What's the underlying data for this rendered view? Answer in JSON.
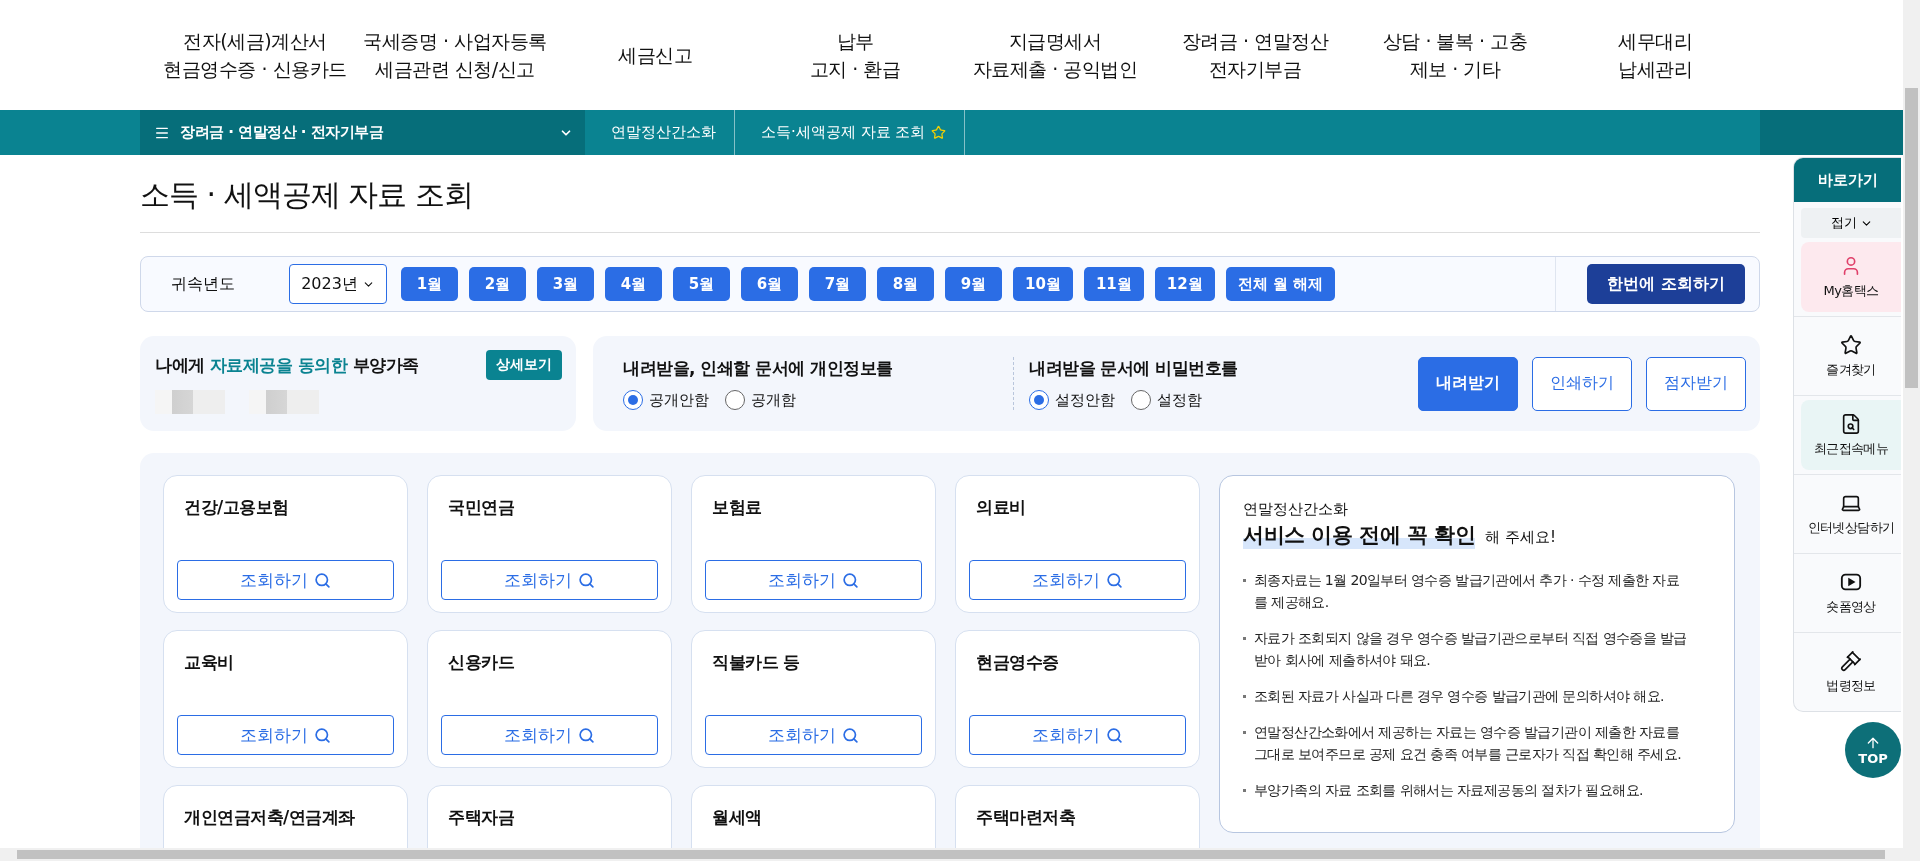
{
  "top_nav": [
    {
      "lines": [
        "전자(세금)계산서",
        "현금영수증 · 신용카드"
      ]
    },
    {
      "lines": [
        "국세증명 · 사업자등록",
        "세금관련 신청/신고"
      ]
    },
    {
      "lines": [
        "세금신고"
      ]
    },
    {
      "lines": [
        "납부",
        "고지 · 환급"
      ]
    },
    {
      "lines": [
        "지급명세서",
        "자료제출 · 공익법인"
      ]
    },
    {
      "lines": [
        "장려금 · 연말정산",
        "전자기부금"
      ]
    },
    {
      "lines": [
        "상담 · 불복 · 고충",
        "제보 · 기타"
      ]
    },
    {
      "lines": [
        "세무대리",
        "납세관리"
      ]
    }
  ],
  "breadcrumb": {
    "menu": "장려금 · 연말정산 · 전자기부금",
    "items": [
      "연말정산간소화",
      "소득·세액공제 자료 조회"
    ]
  },
  "page_title": "소득 · 세액공제 자료 조회",
  "filter": {
    "label": "귀속년도",
    "year": "2023년",
    "months": [
      "1월",
      "2월",
      "3월",
      "4월",
      "5월",
      "6월",
      "7월",
      "8월",
      "9월",
      "10월",
      "11월",
      "12월"
    ],
    "clear": "전체 월 해제",
    "submit": "한번에 조회하기"
  },
  "dependents": {
    "title": "나에게 **자료제공을 동의한** 부양가족",
    "button": "상세보기"
  },
  "options": [
    {
      "title": "내려받을, 인쇄할 문서에 개인정보를",
      "choices": [
        {
          "label": "공개안함",
          "selected": true
        },
        {
          "label": "공개함",
          "selected": false
        }
      ]
    },
    {
      "title": "내려받을 문서에 비밀번호를",
      "choices": [
        {
          "label": "설정안함",
          "selected": true
        },
        {
          "label": "설정함",
          "selected": false
        }
      ]
    }
  ],
  "actions": [
    {
      "label": "내려받기",
      "kind": "primary"
    },
    {
      "label": "인쇄하기",
      "kind": "outline"
    },
    {
      "label": "점자받기",
      "kind": "outline"
    }
  ],
  "cards": [
    {
      "title": "건강/고용보험",
      "button": "조회하기"
    },
    {
      "title": "국민연금",
      "button": "조회하기"
    },
    {
      "title": "보험료",
      "button": "조회하기"
    },
    {
      "title": "의료비",
      "button": "조회하기"
    },
    {
      "title": "교육비",
      "button": "조회하기"
    },
    {
      "title": "신용카드",
      "button": "조회하기"
    },
    {
      "title": "직불카드 등",
      "button": "조회하기"
    },
    {
      "title": "현금영수증",
      "button": "조회하기"
    },
    {
      "title": "개인연금저축/연금계좌"
    },
    {
      "title": "주택자금"
    },
    {
      "title": "월세액"
    },
    {
      "title": "주택마련저축"
    }
  ],
  "notice": {
    "subtitle": "연말정산간소화",
    "heading": "서비스 이용 전에 꼭 확인",
    "heading_suffix": "해 주세요!",
    "items": [
      "최종자료는 1월 20일부터 영수증 발급기관에서 추가 · 수정 제출한 자료를 제공해요.",
      "자료가 조회되지 않을 경우 영수증 발급기관으로부터 직접 영수증을 발급받아 회사에 제출하셔야 돼요.",
      "조회된 자료가 사실과 다른 경우 영수증 발급기관에 문의하셔야 해요.",
      "연말정산간소화에서 제공하는 자료는 영수증 발급기관이 제출한 자료를 그대로 보여주므로 공제 요건 충족 여부를 근로자가 직접 확인해 주세요.",
      "부양가족의 자료 조회를 위해서는 자료제공동의 절차가 필요해요."
    ]
  },
  "quick_menu": {
    "title": "바로가기",
    "collapse": "접기",
    "items": [
      {
        "label": "My홈택스",
        "kind": "person",
        "color": "#fde9ee"
      },
      {
        "label": "즐겨찾기",
        "kind": "star"
      },
      {
        "label": "최근접속메뉴",
        "kind": "search",
        "color": "#e9f5f5"
      },
      {
        "label": "인터넷상담하기",
        "kind": "laptop"
      },
      {
        "label": "숏폼영상",
        "kind": "video"
      },
      {
        "label": "법령정보",
        "kind": "gavel"
      }
    ]
  },
  "top_button": "TOP"
}
